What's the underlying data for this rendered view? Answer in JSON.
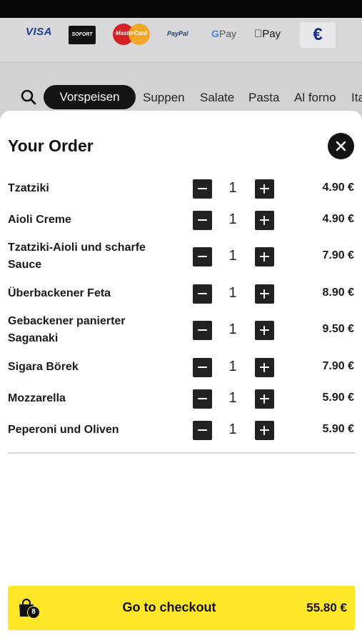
{
  "payment_methods": {
    "visa": "VISA",
    "sofort": "SOFORT",
    "mastercard": "MasterCard",
    "paypal": "PayPal",
    "gpay_g": "G",
    "gpay": "Pay",
    "applepay": "Pay",
    "currency": "€"
  },
  "categories": {
    "active": "Vorspeisen",
    "items": [
      "Suppen",
      "Salate",
      "Pasta",
      "Al forno",
      "Ita"
    ]
  },
  "order": {
    "title": "Your Order",
    "items": [
      {
        "name": "Tzatziki",
        "qty": "1",
        "price": "4.90 €"
      },
      {
        "name": "Aioli Creme",
        "qty": "1",
        "price": "4.90 €"
      },
      {
        "name": "Tzatziki-Aioli und scharfe Sauce",
        "qty": "1",
        "price": "7.90 €"
      },
      {
        "name": "Überbackener Feta",
        "qty": "1",
        "price": "8.90 €"
      },
      {
        "name": "Gebackener panierter Saganaki",
        "qty": "1",
        "price": "9.50 €"
      },
      {
        "name": "Sigara Börek",
        "qty": "1",
        "price": "7.90 €"
      },
      {
        "name": "Mozzarella",
        "qty": "1",
        "price": "5.90 €"
      },
      {
        "name": "Peperoni und Oliven",
        "qty": "1",
        "price": "5.90 €"
      }
    ]
  },
  "checkout": {
    "label": "Go to checkout",
    "total": "55.80 €",
    "badge_count": "8"
  },
  "colors": {
    "accent_yellow": "#ffe629",
    "dark": "#141414"
  },
  "icons": [
    "search-icon",
    "close-icon",
    "minus-icon",
    "plus-icon",
    "shopping-bag-icon"
  ]
}
